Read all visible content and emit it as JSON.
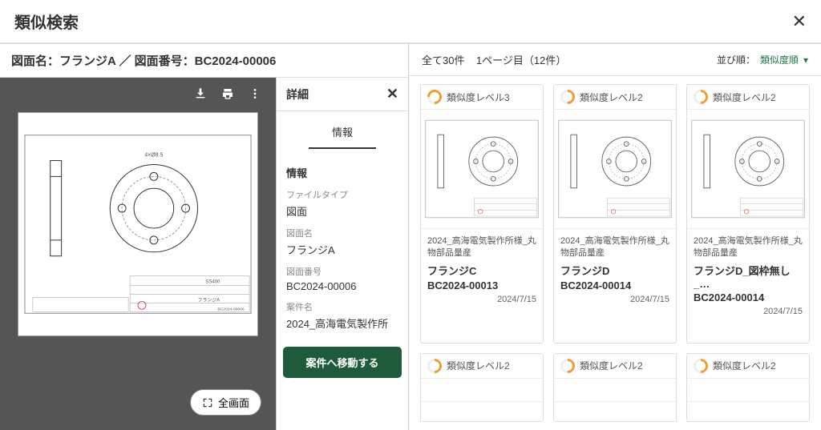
{
  "modal": {
    "title": "類似検索"
  },
  "left": {
    "header": "図面名：フランジA ／ 図面番号：BC2024-00006",
    "fullscreen": "全画面"
  },
  "detail": {
    "title": "詳細",
    "tab": "情報",
    "section": "情報",
    "fields": [
      {
        "label": "ファイルタイプ",
        "value": "図面"
      },
      {
        "label": "図面名",
        "value": "フランジA"
      },
      {
        "label": "図面番号",
        "value": "BC2024-00006"
      },
      {
        "label": "案件名",
        "value": "2024_高海電気製作所"
      }
    ],
    "action": "案件へ移動する"
  },
  "right": {
    "summary_total": "全て30件",
    "summary_page": "1ページ目（12件）",
    "sort_label": "並び順：",
    "sort_value": "類似度順",
    "cards": [
      {
        "level": "類似度レベル3",
        "lv": 3,
        "project": "2024_高海電気製作所様_丸物部品量産",
        "name": "フランジC",
        "num": "BC2024-00013",
        "date": "2024/7/15"
      },
      {
        "level": "類似度レベル2",
        "lv": 2,
        "project": "2024_高海電気製作所様_丸物部品量産",
        "name": "フランジD",
        "num": "BC2024-00014",
        "date": "2024/7/15"
      },
      {
        "level": "類似度レベル2",
        "lv": 2,
        "project": "2024_高海電気製作所様_丸物部品量産",
        "name": "フランジD_図枠無し_…",
        "num": "BC2024-00014",
        "date": "2024/7/15"
      },
      {
        "level": "類似度レベル2",
        "lv": 2,
        "project": "",
        "name": "",
        "num": "",
        "date": ""
      },
      {
        "level": "類似度レベル2",
        "lv": 2,
        "project": "",
        "name": "",
        "num": "",
        "date": ""
      },
      {
        "level": "類似度レベル2",
        "lv": 2,
        "project": "",
        "name": "",
        "num": "",
        "date": ""
      }
    ]
  }
}
